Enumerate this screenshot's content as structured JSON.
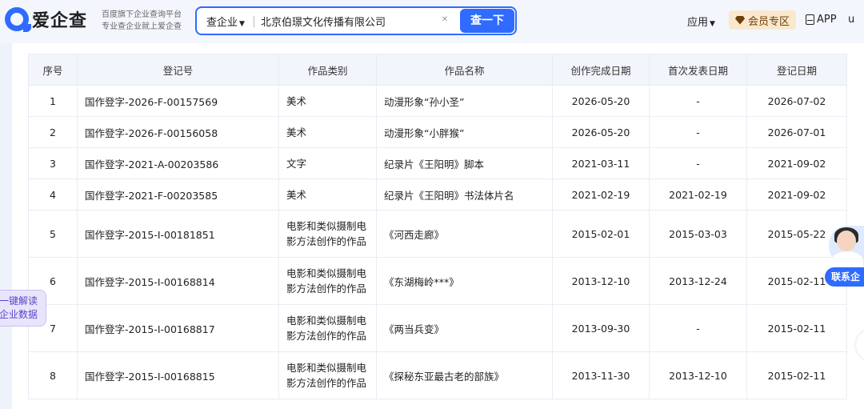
{
  "header": {
    "logo_text": "爱企查",
    "slogan_line1": "百度旗下企业查询平台",
    "slogan_line2": "专业查企业就上爱企查",
    "search_type": "查企业",
    "search_value": "北京伯璟文化传播有限公司",
    "search_button": "查一下",
    "nav_app": "应用",
    "vip_label": "会员专区",
    "app_label": "APP",
    "user_cut": "u"
  },
  "table": {
    "headers": [
      "序号",
      "登记号",
      "作品类别",
      "作品名称",
      "创作完成日期",
      "首次发表日期",
      "登记日期"
    ],
    "rows": [
      {
        "idx": "1",
        "reg_no": "国作登字-2026-F-00157569",
        "category": "美术",
        "name": "动漫形象“孙小圣”",
        "created": "2026-05-20",
        "published": "-",
        "registered": "2026-07-02"
      },
      {
        "idx": "2",
        "reg_no": "国作登字-2026-F-00156058",
        "category": "美术",
        "name": "动漫形象“小胖猴”",
        "created": "2026-05-20",
        "published": "-",
        "registered": "2026-07-01"
      },
      {
        "idx": "3",
        "reg_no": "国作登字-2021-A-00203586",
        "category": "文字",
        "name": "纪录片《王阳明》脚本",
        "created": "2021-03-11",
        "published": "-",
        "registered": "2021-09-02"
      },
      {
        "idx": "4",
        "reg_no": "国作登字-2021-F-00203585",
        "category": "美术",
        "name": "纪录片《王阳明》书法体片名",
        "created": "2021-02-19",
        "published": "2021-02-19",
        "registered": "2021-09-02"
      },
      {
        "idx": "5",
        "reg_no": "国作登字-2015-I-00181851",
        "category": "电影和类似摄制电影方法创作的作品",
        "name": "《河西走廊》",
        "created": "2015-02-01",
        "published": "2015-03-03",
        "registered": "2015-05-22"
      },
      {
        "idx": "6",
        "reg_no": "国作登字-2015-I-00168814",
        "category": "电影和类似摄制电影方法创作的作品",
        "name": "《东湖梅岭***》",
        "created": "2013-12-10",
        "published": "2013-12-24",
        "registered": "2015-02-11"
      },
      {
        "idx": "7",
        "reg_no": "国作登字-2015-I-00168817",
        "category": "电影和类似摄制电影方法创作的作品",
        "name": "《两当兵变》",
        "created": "2013-09-30",
        "published": "-",
        "registered": "2015-02-11"
      },
      {
        "idx": "8",
        "reg_no": "国作登字-2015-I-00168815",
        "category": "电影和类似摄制电影方法创作的作品",
        "name": "《探秘东亚最古老的部族》",
        "created": "2013-11-30",
        "published": "2013-12-10",
        "registered": "2015-02-11"
      }
    ]
  },
  "floats": {
    "left_line1": "一键解读",
    "left_line2": "企业数据",
    "right_button": "联系企"
  },
  "colors": {
    "accent": "#2f6bff",
    "vip_bg": "#fbe8cc",
    "header_bg": "#f2f5fb"
  }
}
